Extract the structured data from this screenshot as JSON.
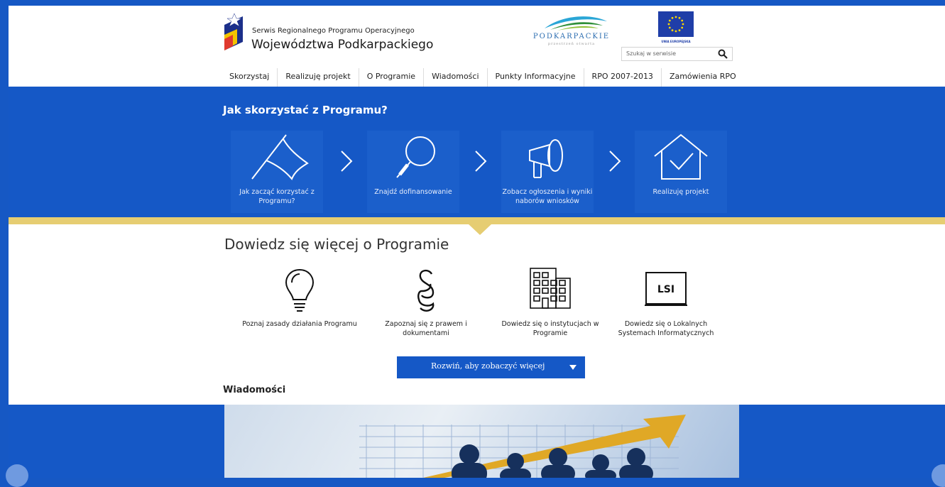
{
  "header": {
    "logo_line1": "Serwis  Regionalnego Programu Operacyjnego",
    "logo_line2": "Województwa Podkarpackiego",
    "partner_logo_name": "PODKARPACKIE",
    "partner_logo_tagline": "przestrzeń otwarta",
    "eu_label": "UNIA EUROPEJSKA",
    "search_placeholder": "Szukaj w serwisie"
  },
  "nav": [
    "Skorzystaj",
    "Realizuję projekt",
    "O Programie",
    "Wiadomości",
    "Punkty Informacyjne",
    "RPO 2007-2013",
    "Zamówienia RPO"
  ],
  "steps_section": {
    "title": "Jak skorzystać z Programu?",
    "steps": [
      {
        "label": "Jak zacząć korzystać z Programu?",
        "icon": "flag-icon"
      },
      {
        "label": "Znajdź dofinansowanie",
        "icon": "magnifier-icon"
      },
      {
        "label": "Zobacz ogłoszenia i wyniki naborów wniosków",
        "icon": "megaphone-icon"
      },
      {
        "label": "Realizuję projekt",
        "icon": "house-check-icon"
      }
    ]
  },
  "learn_section": {
    "title": "Dowiedz się więcej o Programie",
    "items": [
      {
        "label": "Poznaj zasady działania Programu",
        "icon": "lightbulb-icon"
      },
      {
        "label": "Zapoznaj się z prawem i dokumentami",
        "icon": "paragraph-icon"
      },
      {
        "label": "Dowiedz się o instytucjach w Programie",
        "icon": "building-icon"
      },
      {
        "label": "Dowiedz się o Lokalnych Systemach Informatycznych",
        "icon": "lsi-monitor-icon",
        "badge": "LSI"
      }
    ],
    "expand_label": "Rozwiń, aby zobaczyć więcej"
  },
  "news": {
    "title": "Wiadomości"
  },
  "colors": {
    "primary_blue": "#1558c6",
    "gold": "#e6cd72"
  }
}
